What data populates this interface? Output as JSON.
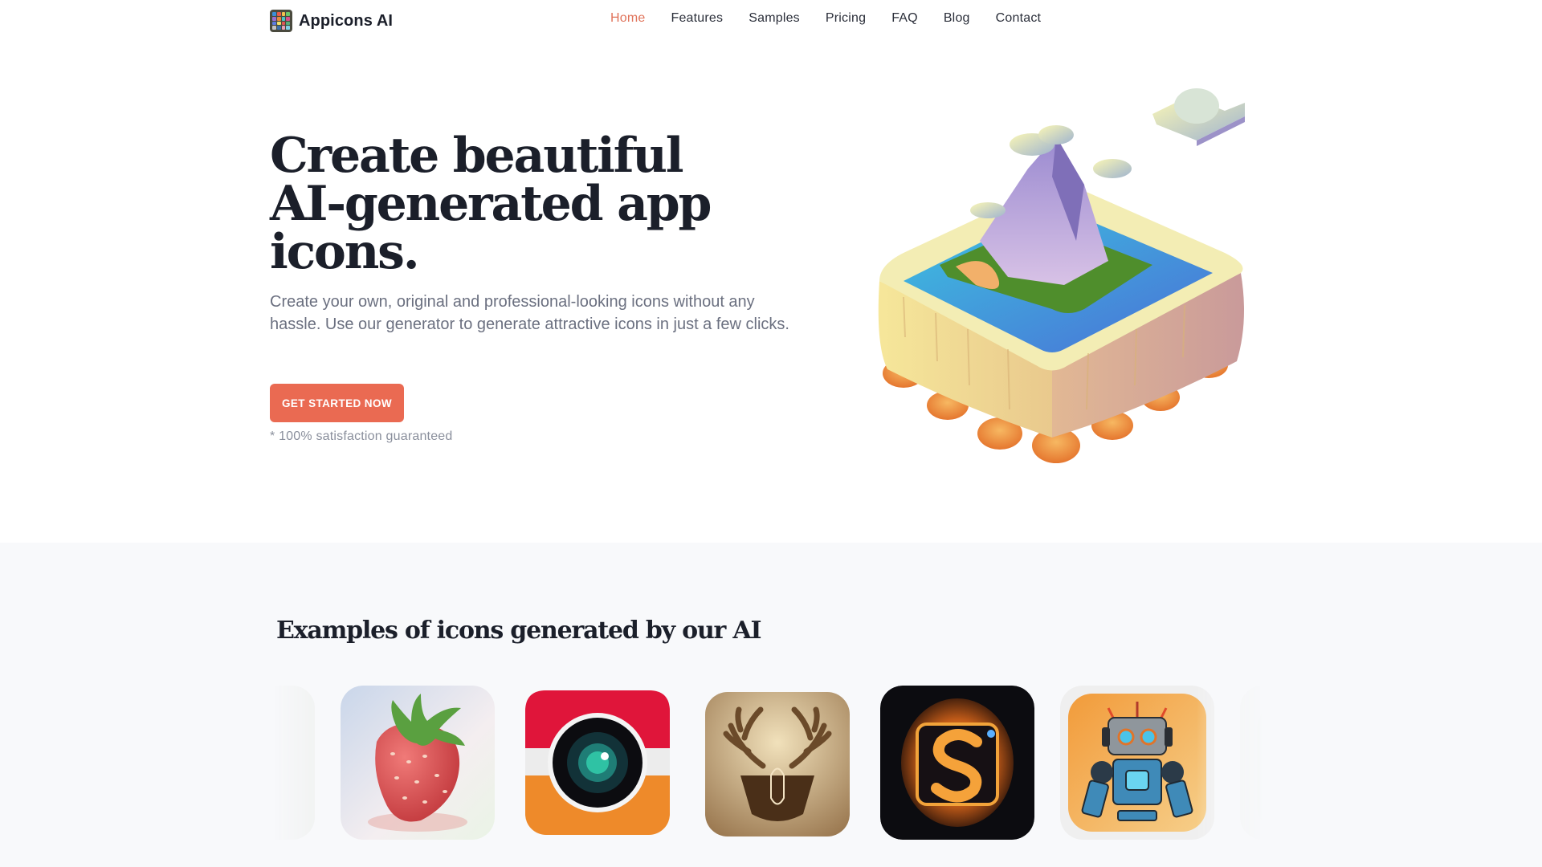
{
  "brand": {
    "name": "Appicons AI",
    "logo_colors": [
      "#3a8fd8",
      "#e85c4a",
      "#f2c14e",
      "#6bc56b",
      "#9b6fd1",
      "#e88a3a",
      "#4ac3c9",
      "#d94f8a",
      "#5b7be0",
      "#f0e06a",
      "#e25555",
      "#56b07a",
      "#c4c4c4",
      "#3b6fa8",
      "#e8a0b8",
      "#7fd1e8"
    ]
  },
  "nav": {
    "items": [
      {
        "label": "Home",
        "active": true
      },
      {
        "label": "Features",
        "active": false
      },
      {
        "label": "Samples",
        "active": false
      },
      {
        "label": "Pricing",
        "active": false
      },
      {
        "label": "FAQ",
        "active": false
      },
      {
        "label": "Blog",
        "active": false
      },
      {
        "label": "Contact",
        "active": false
      }
    ]
  },
  "hero": {
    "title": "Create beautiful AI-generated app icons.",
    "subtitle": "Create your own, original and professional-looking icons without any hassle. Use our generator to generate attractive icons in just a few clicks.",
    "cta_label": "GET STARTED NOW",
    "guarantee": "* 100% satisfaction guaranteed",
    "illustration": "floating-island-mountain-illustration"
  },
  "examples": {
    "title": "Examples of icons generated by our AI",
    "icons": [
      {
        "name": "partial-left-icon"
      },
      {
        "name": "strawberry-icon"
      },
      {
        "name": "camera-icon"
      },
      {
        "name": "deer-antlers-icon"
      },
      {
        "name": "fire-letter-s-icon"
      },
      {
        "name": "robot-icon"
      },
      {
        "name": "partial-green-icon"
      }
    ]
  },
  "colors": {
    "accent": "#ea6a52",
    "nav_active": "#e0735a",
    "heading": "#1b1f2a",
    "muted_text": "#6b7080",
    "section_bg": "#f8f9fb"
  }
}
